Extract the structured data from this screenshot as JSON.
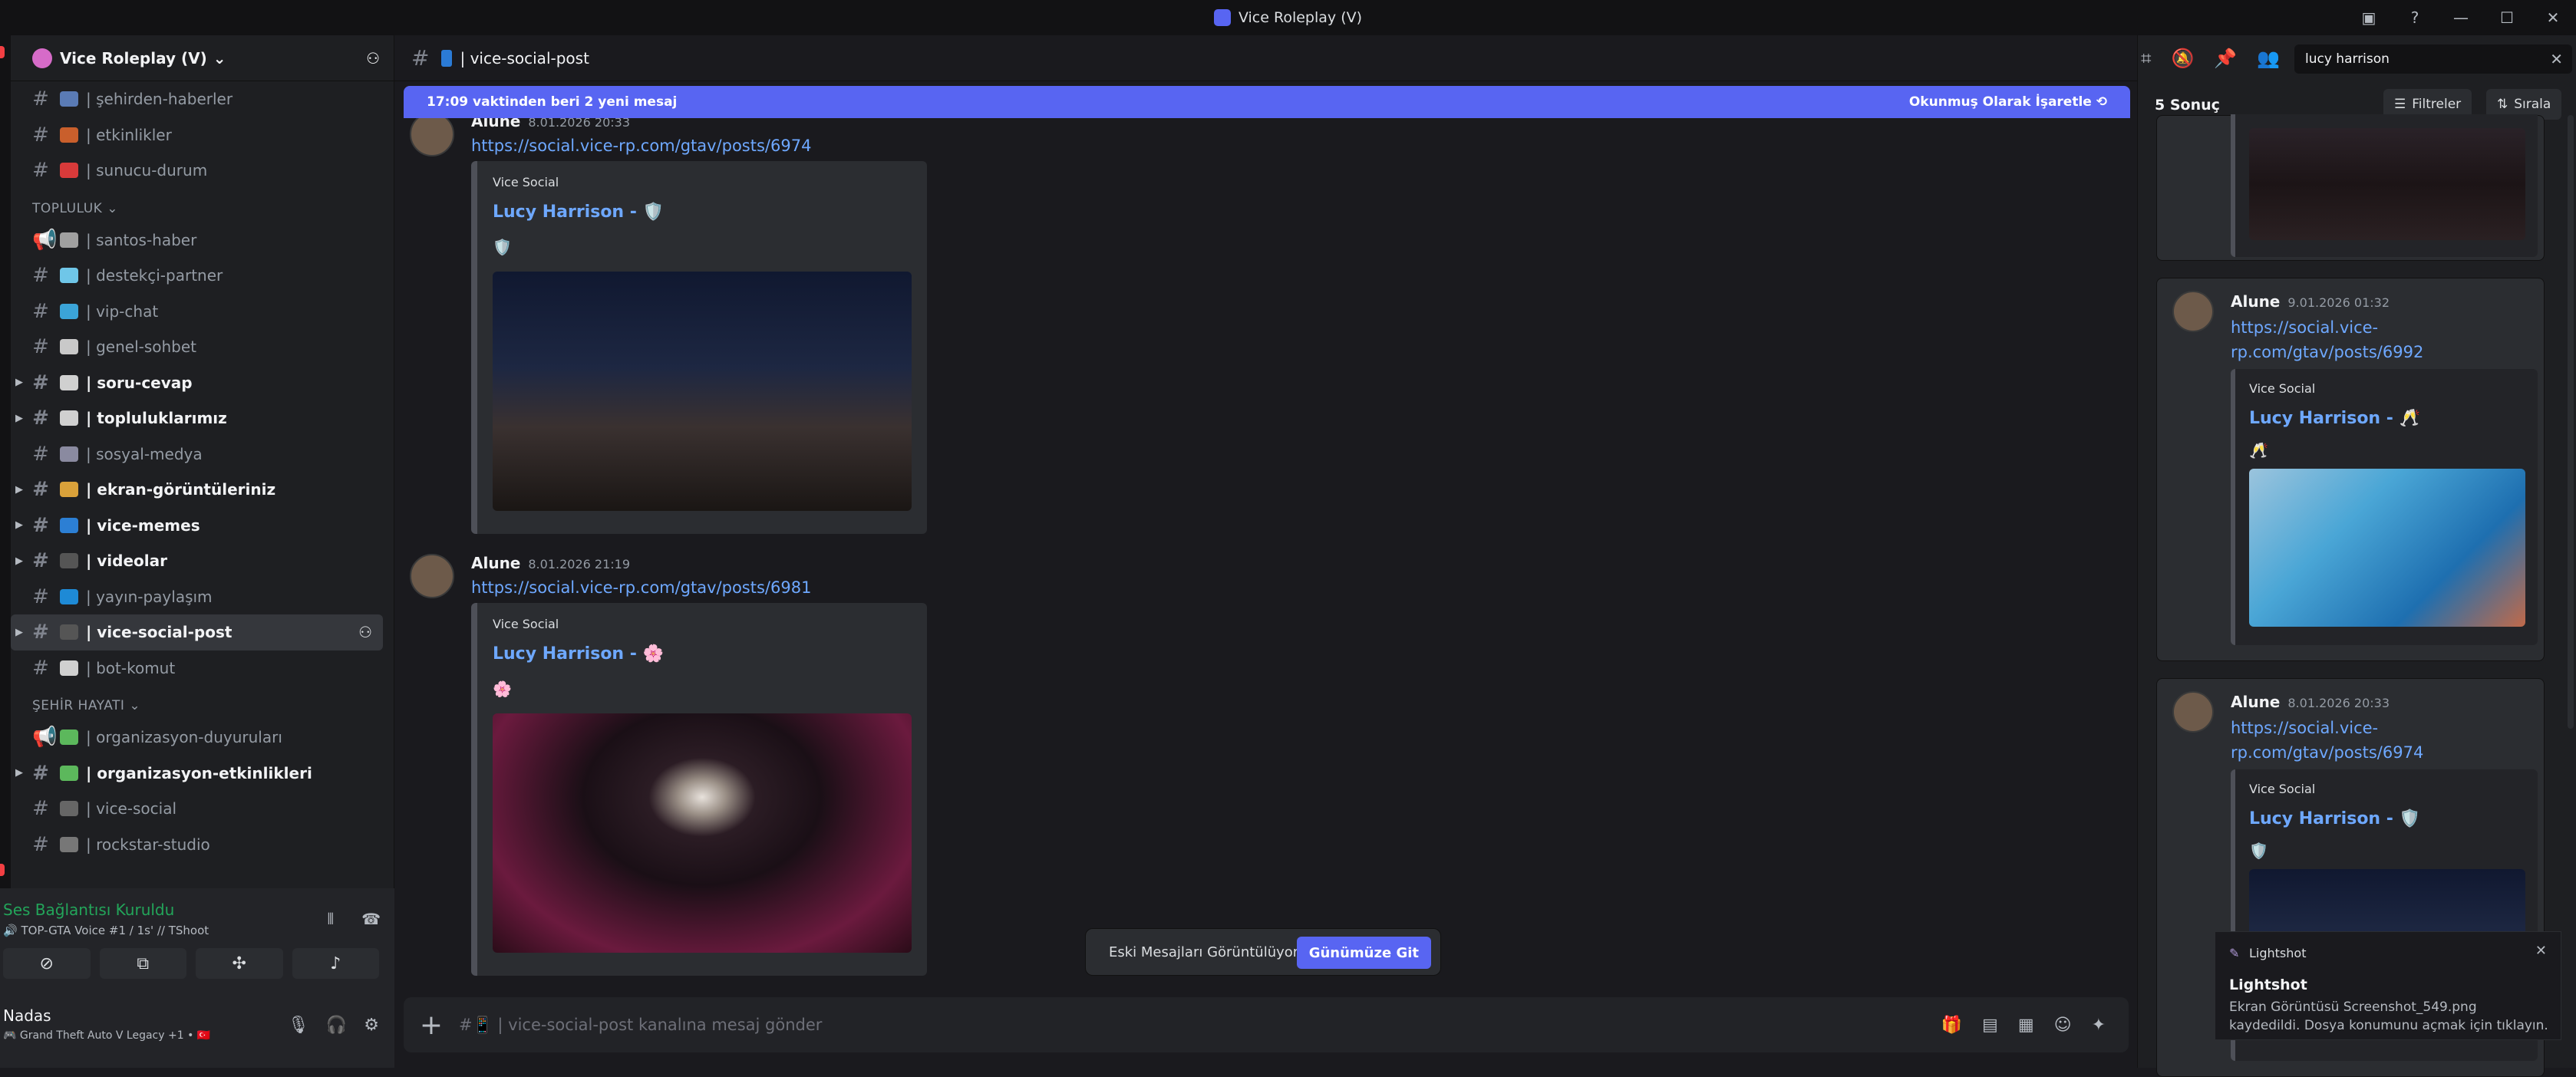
{
  "window": {
    "title": "Vice Roleplay (V)",
    "minimize": "—",
    "maximize": "☐",
    "close": "✕"
  },
  "server": {
    "name": "Vice Roleplay (V)",
    "chevron": "⌄",
    "add_member_icon": "person-add-icon"
  },
  "channels": [
    {
      "type": "text",
      "emoji": "📢",
      "name": "| şehirden-haberler",
      "unread": false
    },
    {
      "type": "text",
      "emoji": "🔆",
      "name": "| etkinlikler",
      "unread": false
    },
    {
      "type": "text",
      "emoji": "📌",
      "name": "| sunucu-durum",
      "unread": false
    }
  ],
  "category_topluluk": "TOPLULUK ⌄",
  "topluluk_channels": [
    {
      "name": "| santos-haber",
      "unread": false,
      "announce": true
    },
    {
      "name": "| destekçi-partner",
      "unread": false
    },
    {
      "name": "| vip-chat",
      "unread": false
    },
    {
      "name": "| genel-sohbet",
      "unread": false
    },
    {
      "name": "| soru-cevap",
      "unread": true,
      "arrow": true
    },
    {
      "name": "| topluluklarımız",
      "unread": true,
      "arrow": true
    },
    {
      "name": "| sosyal-medya",
      "unread": false
    },
    {
      "name": "| ekran-görüntüleriniz",
      "unread": true,
      "arrow": true
    },
    {
      "name": "| vice-memes",
      "unread": true,
      "arrow": true
    },
    {
      "name": "| videolar",
      "unread": true,
      "arrow": true
    },
    {
      "name": "| yayın-paylaşım",
      "unread": false
    },
    {
      "name": "| vice-social-post",
      "active": true,
      "arrow": true
    },
    {
      "name": "| bot-komut",
      "unread": false
    }
  ],
  "category_sehir": "ŞEHİR HAYATI ⌄",
  "sehir_channels": [
    {
      "name": "| organizasyon-duyuruları",
      "unread": false,
      "announce": true
    },
    {
      "name": "| organizasyon-etkinlikleri",
      "unread": true,
      "arrow": true
    },
    {
      "name": "| vice-social",
      "unread": false
    },
    {
      "name": "| rockstar-studio",
      "unread": false
    }
  ],
  "voice": {
    "status": "Ses Bağlantısı Kuruldu",
    "channel": "🔊 TOP-GTA Voice #1 / 1s' // TShoot"
  },
  "user": {
    "name": "Nadas",
    "status": "🎮 Grand Theft Auto V Legacy +1 • 🇹🇷"
  },
  "channel_header": {
    "name": "| vice-social-post"
  },
  "banner": {
    "text": "17:09 vaktinden beri 2 yeni mesaj",
    "action": "Okunmuş Olarak İşaretle"
  },
  "messages": [
    {
      "author": "Alune",
      "time": "8.01.2026 20:33",
      "link": "https://social.vice-rp.com/gtav/posts/6974",
      "provider": "Vice Social",
      "title": "Lucy Harrison - 🛡️",
      "desc": "🛡️"
    },
    {
      "author": "Alune",
      "time": "8.01.2026 21:19",
      "link": "https://social.vice-rp.com/gtav/posts/6981",
      "provider": "Vice Social",
      "title": "Lucy Harrison - 🌸",
      "desc": "🌸"
    }
  ],
  "jump": {
    "text": "Eski Mesajları Görüntülüyorsun",
    "button": "Günümüze Git"
  },
  "composer": {
    "placeholder": "#📱 | vice-social-post kanalına mesaj gönder"
  },
  "search": {
    "query": "lucy harrison",
    "result_count": "5 Sonuç",
    "filter": "Filtreler",
    "sort": "Sırala"
  },
  "results": [
    {
      "author": "Alune",
      "time": "9.01.2026 01:32",
      "link": "https://social.vice-rp.com/gtav/posts/6992",
      "provider": "Vice Social",
      "title": "Lucy Harrison - 🥂",
      "desc": "🥂"
    },
    {
      "author": "Alune",
      "time": "8.01.2026 20:33",
      "link": "https://social.vice-rp.com/gtav/posts/6974",
      "provider": "Vice Social",
      "title": "Lucy Harrison - 🛡️",
      "desc": "🛡️"
    }
  ],
  "toast": {
    "app": "Lightshot",
    "title": "Lightshot",
    "body": "Ekran Görüntüsü Screenshot_549.png kaydedildi. Dosya konumunu açmak için tıklayın."
  }
}
